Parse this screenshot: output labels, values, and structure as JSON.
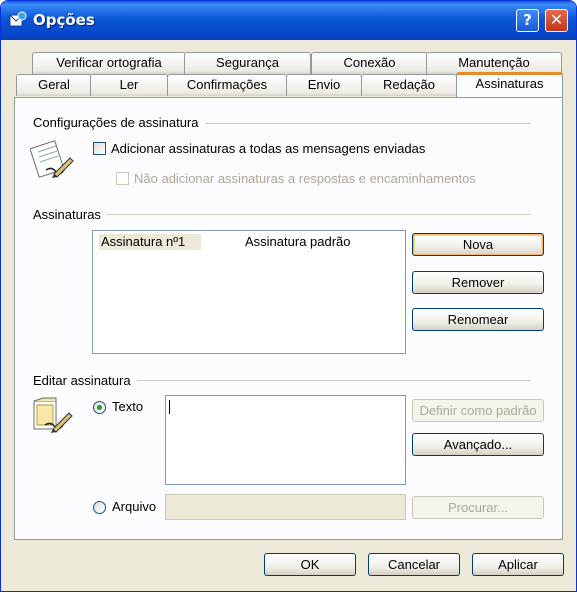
{
  "window": {
    "title": "Opções",
    "help_symbol": "?",
    "close_symbol": "✕"
  },
  "tabs_row1": [
    "Verificar ortografia",
    "Segurança",
    "Conexão",
    "Manutenção"
  ],
  "tabs_row2": [
    "Geral",
    "Ler",
    "Confirmações",
    "Envio",
    "Redação",
    "Assinaturas"
  ],
  "active_tab": "Assinaturas",
  "config_group": {
    "label": "Configurações de assinatura",
    "add_to_all": {
      "label": "Adicionar assinaturas a todas as mensagens enviadas",
      "checked": false
    },
    "no_replies": {
      "label": "Não adicionar assinaturas a respostas e encaminhamentos",
      "checked": false,
      "enabled": false
    }
  },
  "signatures_group": {
    "label": "Assinaturas",
    "list": [
      {
        "name": "Assinatura nº1",
        "type": "Assinatura padrão"
      }
    ],
    "buttons": {
      "new": "Nova",
      "remove": "Remover",
      "rename": "Renomear"
    }
  },
  "edit_group": {
    "label": "Editar assinatura",
    "text_option": "Texto",
    "file_option": "Arquivo",
    "selected": "Texto",
    "text_value": "",
    "file_value": "",
    "set_default": "Definir como padrão",
    "advanced": "Avançado...",
    "browse": "Procurar..."
  },
  "footer": {
    "ok": "OK",
    "cancel": "Cancelar",
    "apply": "Aplicar"
  },
  "colors": {
    "titlebar": "#0a57d6",
    "active_tab_accent": "#e68b2c",
    "dialog_bg": "#ece9d8",
    "radio_dot": "#21a121"
  }
}
